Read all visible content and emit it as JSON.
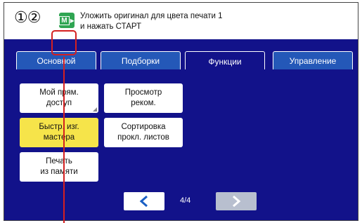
{
  "header": {
    "steps": "①②",
    "status_icon": "machine-status-icon",
    "status_icon_label": "M",
    "message_line1": "Уложить оригинал для цвета печати 1",
    "message_line2": "и нажать СТАРТ"
  },
  "tabs": [
    {
      "label": "Основной",
      "active": false
    },
    {
      "label": "Подборки",
      "active": false
    },
    {
      "label": "Функции",
      "active": true
    },
    {
      "label": "Управление",
      "active": false
    }
  ],
  "functions": [
    {
      "line1": "Мой прям.",
      "line2": "доступ",
      "selected": false
    },
    {
      "line1": "Просмотр",
      "line2": "реком.",
      "selected": false
    },
    {
      "line1": "Быстр. изг.",
      "line2": "мастера",
      "selected": true
    },
    {
      "line1": "Сортировка",
      "line2": "прокл. листов",
      "selected": false
    },
    {
      "line1": "Печать",
      "line2": "из памяти",
      "selected": false
    }
  ],
  "pager": {
    "label": "4/4",
    "prev_icon": "chevron-left-icon",
    "next_icon": "chevron-right-icon"
  },
  "colors": {
    "panel": "#12128a",
    "tab": "#2458b8",
    "selected": "#f6e44a",
    "callout": "#d42020",
    "status": "#2fa552"
  }
}
